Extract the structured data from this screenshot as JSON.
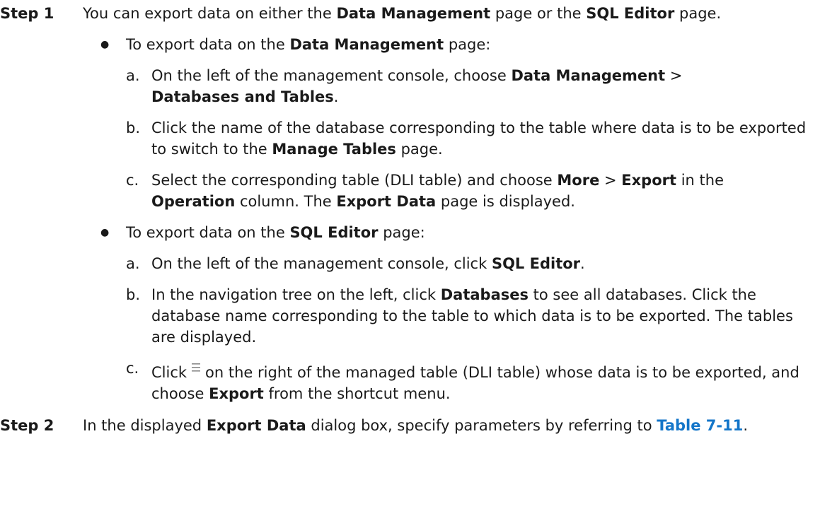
{
  "step1": {
    "label": "Step 1",
    "t1": "You can export data on either the ",
    "b1": "Data Management",
    "t2": " page or the ",
    "b2": "SQL Editor",
    "t3": " page.",
    "bullet1": {
      "t1": "To export data on the ",
      "b1": "Data Management",
      "t2": " page:",
      "a": {
        "marker": "a.",
        "t1": "On the left of the management console, choose ",
        "b1": "Data Management",
        "t2": " > ",
        "b2": "Databases and Tables",
        "t3": "."
      },
      "b": {
        "marker": "b.",
        "t1": "Click the name of the database corresponding to the table where data is to be exported to switch to the ",
        "b1": "Manage Tables",
        "t2": " page."
      },
      "c": {
        "marker": "c.",
        "t1": "Select the corresponding table (DLI table) and choose ",
        "b1": "More",
        "t2": " > ",
        "b2": "Export",
        "t3": " in the ",
        "b3": "Operation",
        "t4": " column. The ",
        "b4": "Export Data",
        "t5": " page is displayed."
      }
    },
    "bullet2": {
      "t1": "To export data on the ",
      "b1": "SQL Editor",
      "t2": " page:",
      "a": {
        "marker": "a.",
        "t1": "On the left of the management console, click ",
        "b1": "SQL Editor",
        "t2": "."
      },
      "b": {
        "marker": "b.",
        "t1": "In the navigation tree on the left, click ",
        "b1": "Databases",
        "t2": " to see all databases. Click the database name corresponding to the table to which data is to be exported. The tables are displayed."
      },
      "c": {
        "marker": "c.",
        "t1": "Click",
        "t2": "on the right of the managed table (DLI table) whose data is to be exported, and choose ",
        "b1": "Export",
        "t3": " from the shortcut menu."
      }
    }
  },
  "step2": {
    "label": "Step 2",
    "t1": "In the displayed ",
    "b1": "Export Data",
    "t2": " dialog box, specify parameters by referring to ",
    "link": "Table 7-11",
    "t3": "."
  },
  "icons": {
    "menu": "menu-lines-icon",
    "bullet": "bullet-dot-icon"
  },
  "colors": {
    "text": "#1a1a1a",
    "link": "#1476c9",
    "icon": "#8a8a8a"
  }
}
